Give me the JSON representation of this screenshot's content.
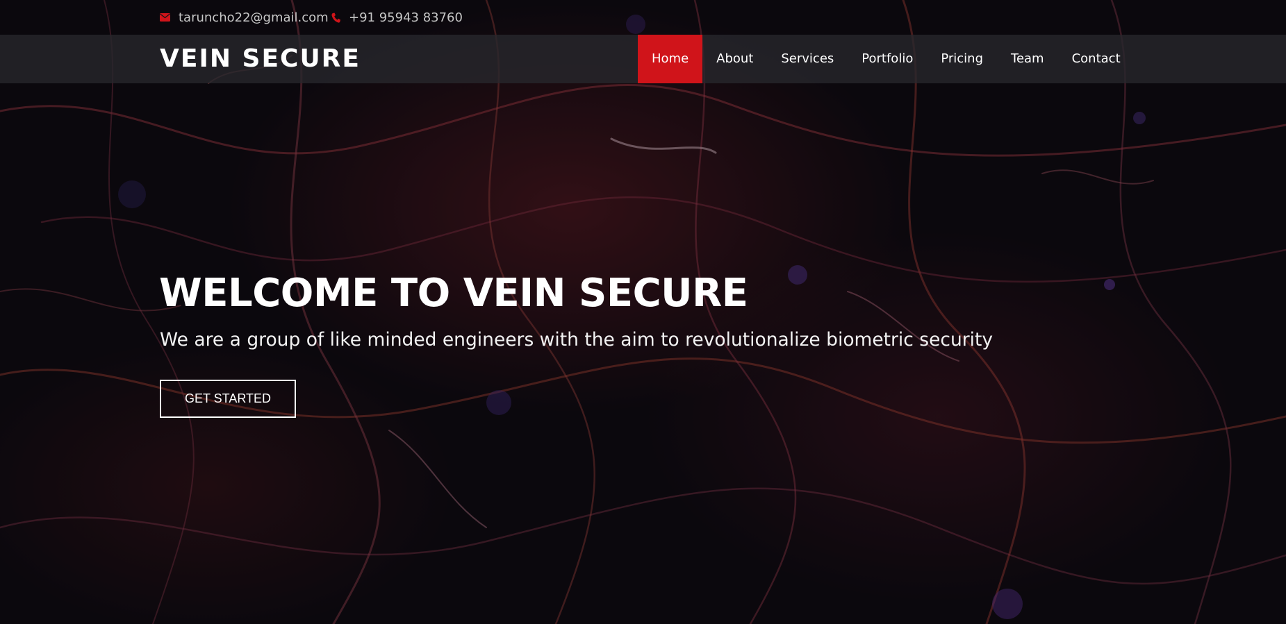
{
  "topbar": {
    "email": "taruncho22@gmail.com",
    "phone": "+91 95943 83760",
    "email_icon": "envelope-icon",
    "phone_icon": "phone-icon",
    "icon_color": "#d0141a"
  },
  "navbar": {
    "logo": "VEIN SECURE",
    "items": [
      {
        "label": "Home",
        "active": true
      },
      {
        "label": "About",
        "active": false
      },
      {
        "label": "Services",
        "active": false
      },
      {
        "label": "Portfolio",
        "active": false
      },
      {
        "label": "Pricing",
        "active": false
      },
      {
        "label": "Team",
        "active": false
      },
      {
        "label": "Contact",
        "active": false
      }
    ],
    "active_color": "#d0141a"
  },
  "hero": {
    "title": "WELCOME TO VEIN SECURE",
    "subtitle": "We are a group of like minded engineers with the aim to revolutionalize biometric security",
    "cta_label": "GET STARTED"
  }
}
